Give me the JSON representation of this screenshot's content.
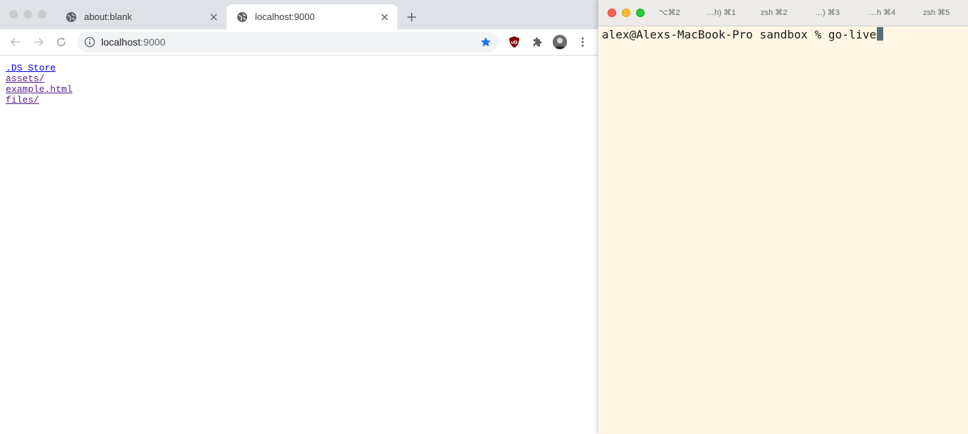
{
  "browser": {
    "tabs": [
      {
        "title": "about:blank",
        "active": false
      },
      {
        "title": "localhost:9000",
        "active": true
      }
    ],
    "address": {
      "host": "localhost",
      "port": ":9000"
    },
    "content": {
      "files": [
        ".DS_Store",
        "assets/",
        "example.html",
        "files/"
      ]
    }
  },
  "terminal": {
    "tabs": [
      "⌥⌘2",
      "…h) ⌘1",
      "zsh ⌘2",
      "…)  ⌘3",
      "…h  ⌘4",
      "zsh ⌘5"
    ],
    "prompt": "alex@Alexs-MacBook-Pro sandbox % ",
    "command": "go-live"
  },
  "colors": {
    "star": "#1a73e8",
    "link": "#0000ee",
    "visited_link": "#551a8b",
    "terminal_bg": "#fdf6e3",
    "ublock": "#800000"
  },
  "icons": {
    "tab_favicon": "globe-icon",
    "tab_close": "close-icon",
    "new_tab": "plus-icon",
    "back": "arrow-left-icon",
    "forward": "arrow-right-icon",
    "reload": "reload-icon",
    "site_info": "info-icon",
    "bookmark": "star-icon",
    "ublock": "ublock-shield-icon",
    "extensions": "puzzle-icon",
    "profile": "avatar",
    "menu": "kebab-menu-icon"
  }
}
